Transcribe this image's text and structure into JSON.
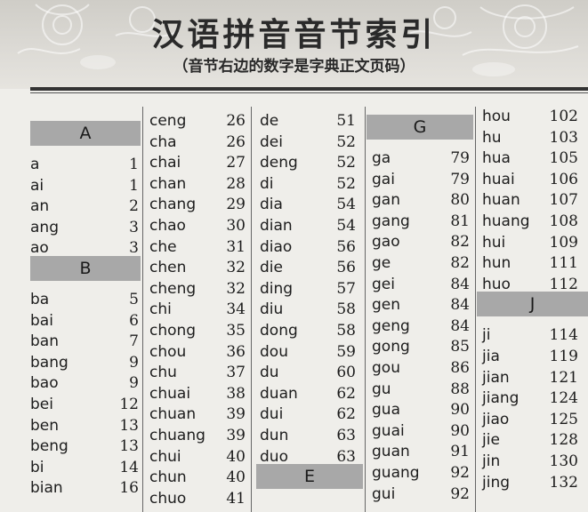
{
  "header": {
    "title": "汉语拼音音节索引",
    "subtitle": "（音节右边的数字是字典正文页码）"
  },
  "columns": [
    {
      "items": [
        {
          "type": "heading",
          "label": "A"
        },
        {
          "type": "entry",
          "syllable": "a",
          "page": "1"
        },
        {
          "type": "entry",
          "syllable": "ai",
          "page": "1"
        },
        {
          "type": "entry",
          "syllable": "an",
          "page": "2"
        },
        {
          "type": "entry",
          "syllable": "ang",
          "page": "3"
        },
        {
          "type": "entry",
          "syllable": "ao",
          "page": "3"
        },
        {
          "type": "heading",
          "label": "B"
        },
        {
          "type": "entry",
          "syllable": "ba",
          "page": "5"
        },
        {
          "type": "entry",
          "syllable": "bai",
          "page": "6"
        },
        {
          "type": "entry",
          "syllable": "ban",
          "page": "7"
        },
        {
          "type": "entry",
          "syllable": "bang",
          "page": "9"
        },
        {
          "type": "entry",
          "syllable": "bao",
          "page": "9"
        },
        {
          "type": "entry",
          "syllable": "bei",
          "page": "12"
        },
        {
          "type": "entry",
          "syllable": "ben",
          "page": "13"
        },
        {
          "type": "entry",
          "syllable": "beng",
          "page": "13"
        },
        {
          "type": "entry",
          "syllable": "bi",
          "page": "14"
        },
        {
          "type": "entry",
          "syllable": "bian",
          "page": "16"
        }
      ]
    },
    {
      "items": [
        {
          "type": "entry",
          "syllable": "ceng",
          "page": "26"
        },
        {
          "type": "entry",
          "syllable": "cha",
          "page": "26"
        },
        {
          "type": "entry",
          "syllable": "chai",
          "page": "27"
        },
        {
          "type": "entry",
          "syllable": "chan",
          "page": "28"
        },
        {
          "type": "entry",
          "syllable": "chang",
          "page": "29"
        },
        {
          "type": "entry",
          "syllable": "chao",
          "page": "30"
        },
        {
          "type": "entry",
          "syllable": "che",
          "page": "31"
        },
        {
          "type": "entry",
          "syllable": "chen",
          "page": "32"
        },
        {
          "type": "entry",
          "syllable": "cheng",
          "page": "32"
        },
        {
          "type": "entry",
          "syllable": "chi",
          "page": "34"
        },
        {
          "type": "entry",
          "syllable": "chong",
          "page": "35"
        },
        {
          "type": "entry",
          "syllable": "chou",
          "page": "36"
        },
        {
          "type": "entry",
          "syllable": "chu",
          "page": "37"
        },
        {
          "type": "entry",
          "syllable": "chuai",
          "page": "38"
        },
        {
          "type": "entry",
          "syllable": "chuan",
          "page": "39"
        },
        {
          "type": "entry",
          "syllable": "chuang",
          "page": "39"
        },
        {
          "type": "entry",
          "syllable": "chui",
          "page": "40"
        },
        {
          "type": "entry",
          "syllable": "chun",
          "page": "40"
        },
        {
          "type": "entry",
          "syllable": "chuo",
          "page": "41"
        }
      ]
    },
    {
      "items": [
        {
          "type": "entry",
          "syllable": "de",
          "page": "51"
        },
        {
          "type": "entry",
          "syllable": "dei",
          "page": "52"
        },
        {
          "type": "entry",
          "syllable": "deng",
          "page": "52"
        },
        {
          "type": "entry",
          "syllable": "di",
          "page": "52"
        },
        {
          "type": "entry",
          "syllable": "dia",
          "page": "54"
        },
        {
          "type": "entry",
          "syllable": "dian",
          "page": "54"
        },
        {
          "type": "entry",
          "syllable": "diao",
          "page": "56"
        },
        {
          "type": "entry",
          "syllable": "die",
          "page": "56"
        },
        {
          "type": "entry",
          "syllable": "ding",
          "page": "57"
        },
        {
          "type": "entry",
          "syllable": "diu",
          "page": "58"
        },
        {
          "type": "entry",
          "syllable": "dong",
          "page": "58"
        },
        {
          "type": "entry",
          "syllable": "dou",
          "page": "59"
        },
        {
          "type": "entry",
          "syllable": "du",
          "page": "60"
        },
        {
          "type": "entry",
          "syllable": "duan",
          "page": "62"
        },
        {
          "type": "entry",
          "syllable": "dui",
          "page": "62"
        },
        {
          "type": "entry",
          "syllable": "dun",
          "page": "63"
        },
        {
          "type": "entry",
          "syllable": "duo",
          "page": "63"
        },
        {
          "type": "heading",
          "label": "E"
        }
      ]
    },
    {
      "items": [
        {
          "type": "heading",
          "label": "G"
        },
        {
          "type": "entry",
          "syllable": "ga",
          "page": "79"
        },
        {
          "type": "entry",
          "syllable": "gai",
          "page": "79"
        },
        {
          "type": "entry",
          "syllable": "gan",
          "page": "80"
        },
        {
          "type": "entry",
          "syllable": "gang",
          "page": "81"
        },
        {
          "type": "entry",
          "syllable": "gao",
          "page": "82"
        },
        {
          "type": "entry",
          "syllable": "ge",
          "page": "82"
        },
        {
          "type": "entry",
          "syllable": "gei",
          "page": "84"
        },
        {
          "type": "entry",
          "syllable": "gen",
          "page": "84"
        },
        {
          "type": "entry",
          "syllable": "geng",
          "page": "84"
        },
        {
          "type": "entry",
          "syllable": "gong",
          "page": "85"
        },
        {
          "type": "entry",
          "syllable": "gou",
          "page": "86"
        },
        {
          "type": "entry",
          "syllable": "gu",
          "page": "88"
        },
        {
          "type": "entry",
          "syllable": "gua",
          "page": "90"
        },
        {
          "type": "entry",
          "syllable": "guai",
          "page": "90"
        },
        {
          "type": "entry",
          "syllable": "guan",
          "page": "91"
        },
        {
          "type": "entry",
          "syllable": "guang",
          "page": "92"
        },
        {
          "type": "entry",
          "syllable": "gui",
          "page": "92"
        }
      ]
    },
    {
      "items": [
        {
          "type": "entry",
          "syllable": "hou",
          "page": "102"
        },
        {
          "type": "entry",
          "syllable": "hu",
          "page": "103"
        },
        {
          "type": "entry",
          "syllable": "hua",
          "page": "105"
        },
        {
          "type": "entry",
          "syllable": "huai",
          "page": "106"
        },
        {
          "type": "entry",
          "syllable": "huan",
          "page": "107"
        },
        {
          "type": "entry",
          "syllable": "huang",
          "page": "108"
        },
        {
          "type": "entry",
          "syllable": "hui",
          "page": "109"
        },
        {
          "type": "entry",
          "syllable": "hun",
          "page": "111"
        },
        {
          "type": "entry",
          "syllable": "huo",
          "page": "112"
        },
        {
          "type": "heading",
          "label": "J"
        },
        {
          "type": "entry",
          "syllable": "ji",
          "page": "114"
        },
        {
          "type": "entry",
          "syllable": "jia",
          "page": "119"
        },
        {
          "type": "entry",
          "syllable": "jian",
          "page": "121"
        },
        {
          "type": "entry",
          "syllable": "jiang",
          "page": "124"
        },
        {
          "type": "entry",
          "syllable": "jiao",
          "page": "125"
        },
        {
          "type": "entry",
          "syllable": "jie",
          "page": "128"
        },
        {
          "type": "entry",
          "syllable": "jin",
          "page": "130"
        },
        {
          "type": "entry",
          "syllable": "jing",
          "page": "132"
        }
      ]
    }
  ]
}
